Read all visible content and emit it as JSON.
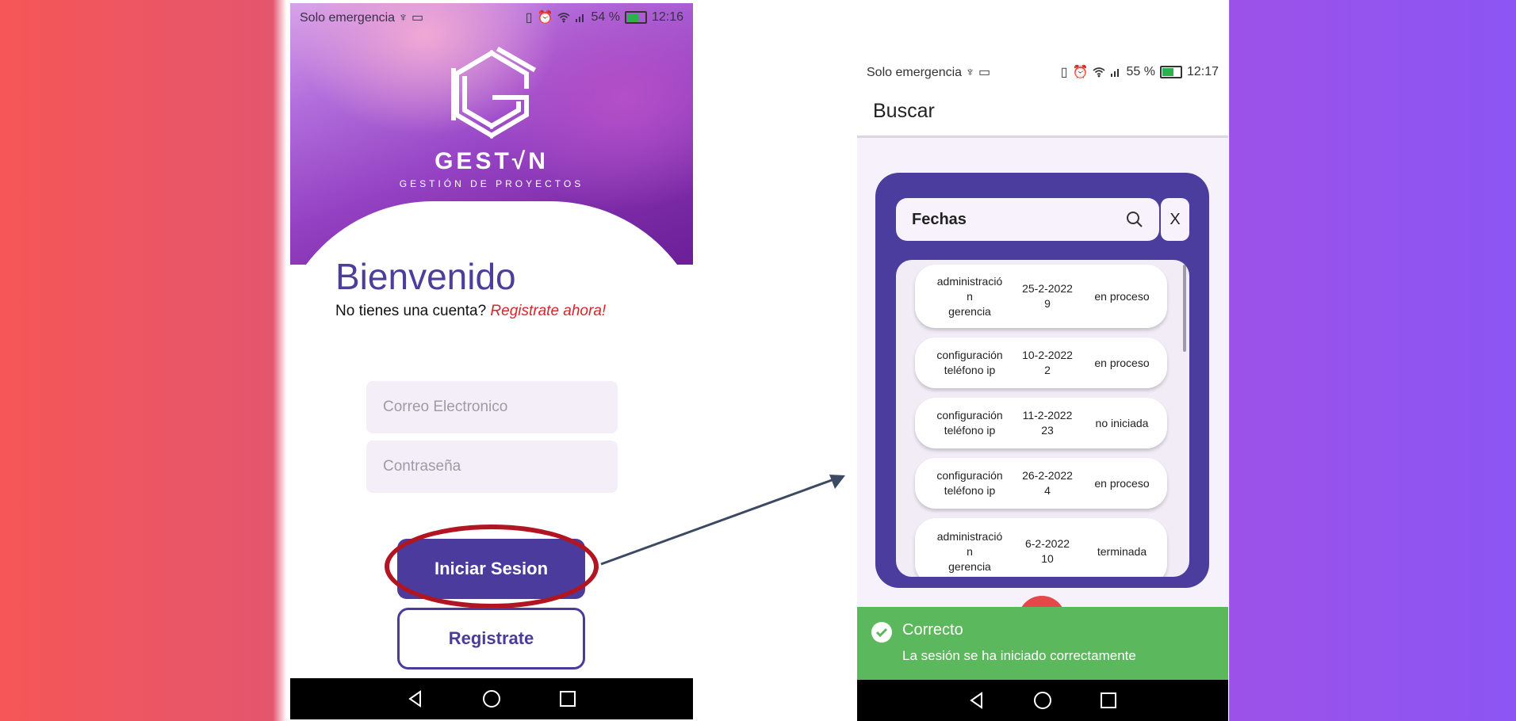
{
  "left_phone": {
    "status": {
      "network": "Solo emergencia",
      "battery": "54 %",
      "time": "12:16"
    },
    "logo": {
      "brand": "GEST√N",
      "tagline": "GESTIÓN DE PROYECTOS"
    },
    "welcome_title": "Bienvenido",
    "account_prompt": "No tienes una cuenta?",
    "register_link": "Registrate ahora!",
    "email_placeholder": "Correo Electronico",
    "password_placeholder": "Contraseña",
    "login_button": "Iniciar Sesion",
    "register_button": "Registrate"
  },
  "right_phone": {
    "status": {
      "network": "Solo emergencia",
      "battery": "55 %",
      "time": "12:17"
    },
    "appbar_title": "Buscar",
    "search": {
      "label": "Fechas",
      "close": "X"
    },
    "rows": [
      {
        "name_line1": "administració",
        "name_line2": "n",
        "name_line3": "gerencia",
        "date": "25-2-2022",
        "count": "9",
        "status": "en proceso"
      },
      {
        "name_line1": "configuración",
        "name_line2": "teléfono ip",
        "name_line3": "",
        "date": "10-2-2022",
        "count": "2",
        "status": "en proceso"
      },
      {
        "name_line1": "configuración",
        "name_line2": "teléfono ip",
        "name_line3": "",
        "date": "11-2-2022",
        "count": "23",
        "status": "no iniciada"
      },
      {
        "name_line1": "configuración",
        "name_line2": "teléfono ip",
        "name_line3": "",
        "date": "26-2-2022",
        "count": "4",
        "status": "en proceso"
      },
      {
        "name_line1": "administració",
        "name_line2": "n",
        "name_line3": "gerencia",
        "date": "6-2-2022",
        "count": "10",
        "status": "terminada"
      }
    ],
    "toast": {
      "title": "Correcto",
      "message": "La sesión se ha iniciado correctamente"
    }
  },
  "colors": {
    "primary": "#4b3b9c",
    "highlight_ring": "#b11521",
    "toast_bg": "#5cb85c",
    "link_red": "#d6262b"
  },
  "icons": [
    "usb-icon",
    "laptop-icon",
    "vibrate-icon",
    "alarm-icon",
    "wifi-icon",
    "signal-icon",
    "battery-icon",
    "search-icon",
    "check-circle-icon",
    "nav-back-icon",
    "nav-home-icon",
    "nav-recent-icon"
  ]
}
